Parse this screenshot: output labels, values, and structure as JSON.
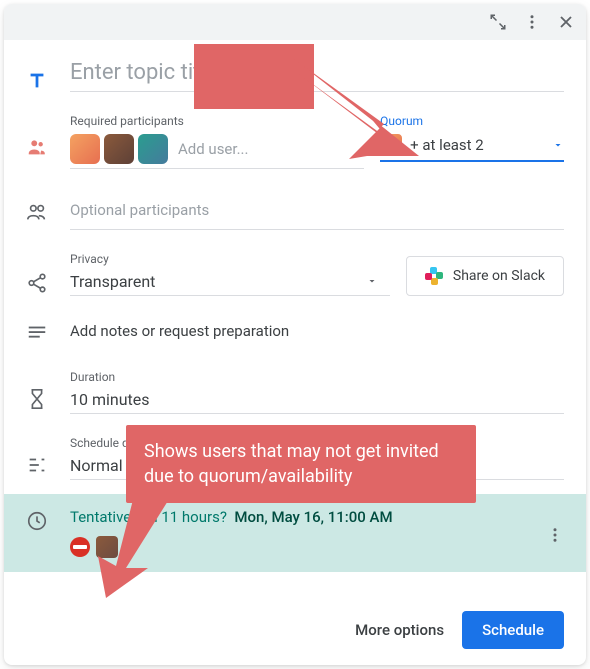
{
  "titlebar": {},
  "topic": {
    "placeholder": "Enter topic title"
  },
  "required": {
    "label": "Required participants",
    "add_placeholder": "Add user..."
  },
  "quorum": {
    "label": "Quorum",
    "value": "+ at least 2"
  },
  "optional": {
    "placeholder": "Optional participants"
  },
  "privacy": {
    "label": "Privacy",
    "value": "Transparent"
  },
  "slack": {
    "label": "Share on Slack"
  },
  "notes": {
    "placeholder": "Add notes or request preparation"
  },
  "duration": {
    "label": "Duration",
    "value": "10 minutes"
  },
  "urgency": {
    "label": "Schedule duration",
    "value": "Normal urgency"
  },
  "tentative": {
    "prefix": "Tentatively in",
    "hours": "11 hours?",
    "datetime": "Mon, May 16, 11:00 AM"
  },
  "footer": {
    "more": "More options",
    "schedule": "Schedule"
  },
  "annotation": {
    "text": "Shows users that may not get invited due to quorum/availability"
  },
  "colors": {
    "accent": "#1a73e8",
    "teal": "#cce8e4",
    "callout": "#e06666"
  }
}
